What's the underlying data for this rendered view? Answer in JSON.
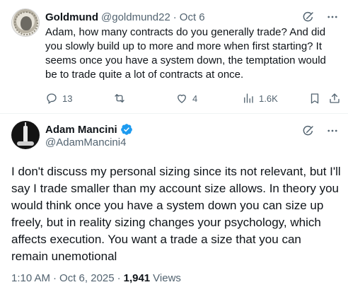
{
  "reply": {
    "author_name": "Goldmund",
    "handle": "@goldmund22",
    "separator": "·",
    "date": "Oct 6",
    "text": "Adam, how many contracts do you generally trade? And did you slowly build up to more and more when first starting? It seems once you have a system down, the temptation would be to trade quite a lot of contracts at once.",
    "replies_count": "13",
    "likes_count": "4",
    "views_count": "1.6K",
    "avatar_icon": "portrait-coin-icon"
  },
  "main": {
    "author_name": "Adam Mancini",
    "handle": "@AdamMancini4",
    "text": "I don't discuss my personal sizing since its not relevant, but I'll say I trade smaller than my account size allows. In theory you would think once you have a system down you can size up freely, but in reality sizing changes your psychology, which affects execution. You want a trade a size that you can remain unemotional",
    "time": "1:10 AM",
    "separator": "·",
    "date": "Oct 6, 2025",
    "separator2": "·",
    "views_count": "1,941",
    "views_label": "Views",
    "avatar_icon": "tower-night-icon"
  },
  "colors": {
    "text": "#0f1419",
    "muted": "#536471",
    "verified": "#1d9bf0",
    "divider": "#eff3f4"
  }
}
